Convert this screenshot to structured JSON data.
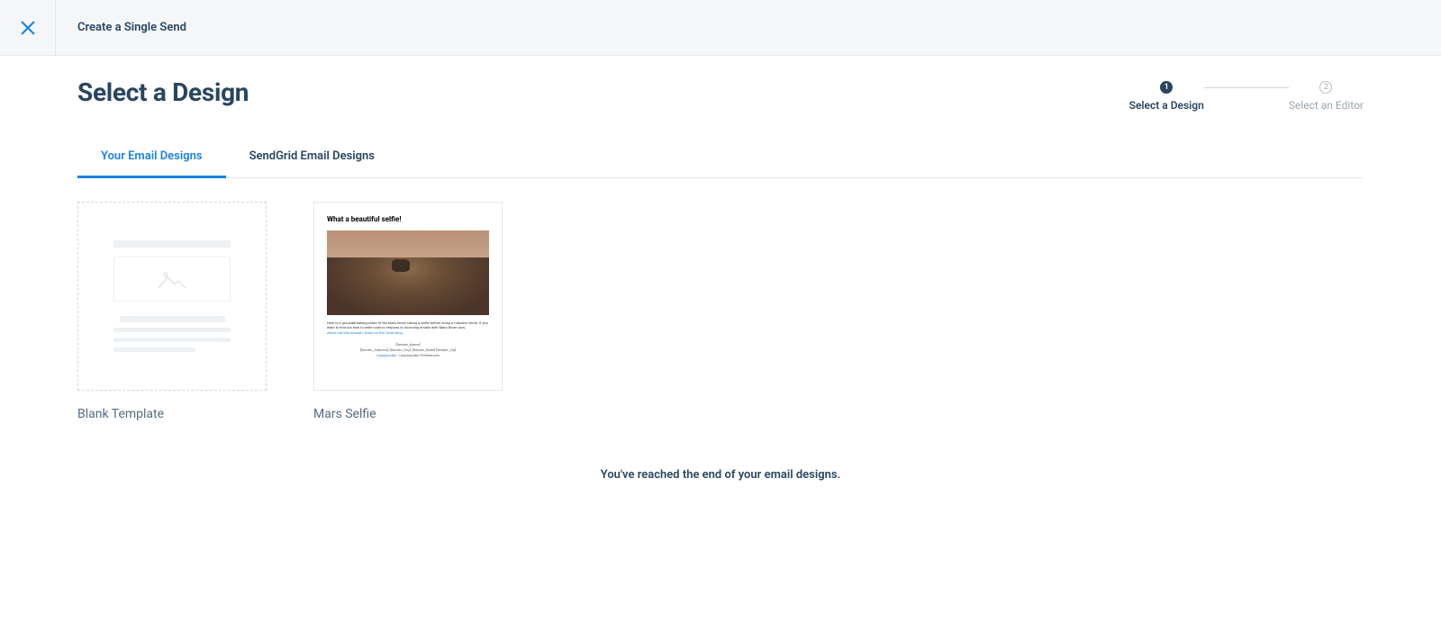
{
  "header": {
    "title": "Create a Single Send"
  },
  "page": {
    "title": "Select a Design"
  },
  "stepper": {
    "step1": {
      "number": "1",
      "label": "Select a Design"
    },
    "step2": {
      "number": "2",
      "label": "Select an Editor"
    }
  },
  "tabs": {
    "your_designs": "Your Email Designs",
    "sendgrid_designs": "SendGrid Email Designs"
  },
  "designs": {
    "blank": {
      "label": "Blank Template"
    },
    "mars": {
      "label": "Mars Selfie",
      "preview": {
        "title": "What a beautiful selfie!",
        "body": "Here is a groundbreaking photo of the Mars Rover taking a selfie before doing a massive climb. If you want to find out how to write code to respond to incoming emails with Mars Rover pics,",
        "link": "check out this tutorial I wrote on the Twilio blog.",
        "footer1": "[Sender_Name]",
        "footer2": "[Sender_Address], [Sender_City], [Sender_State] [Sender_Zip]",
        "footer_unsub": "Unsubscribe",
        "footer_prefs": " - Unsubscribe Preferences"
      }
    }
  },
  "end_message": "You've reached the end of your email designs."
}
